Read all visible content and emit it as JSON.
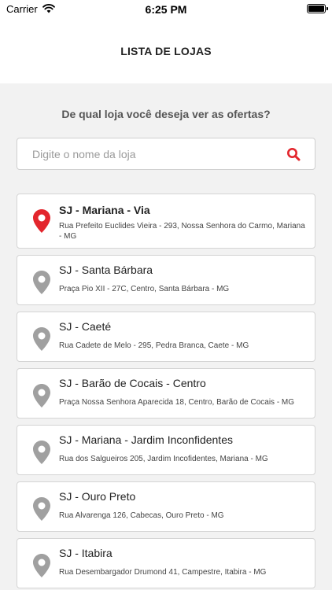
{
  "status_bar": {
    "carrier": "Carrier",
    "time": "6:25 PM"
  },
  "header": {
    "title": "LISTA DE LOJAS"
  },
  "prompt": "De qual loja você deseja ver as ofertas?",
  "search": {
    "placeholder": "Digite o nome da loja",
    "value": ""
  },
  "colors": {
    "accent": "#e3262d",
    "pin_inactive": "#a0a0a0"
  },
  "stores": [
    {
      "name": "SJ - Mariana - Via",
      "address": "Rua Prefeito Euclides Vieira - 293, Nossa Senhora do Carmo, Mariana - MG",
      "selected": true,
      "icon": "map-pin-icon"
    },
    {
      "name": "SJ - Santa Bárbara",
      "address": "Praça Pio XII - 27C, Centro, Santa Bárbara - MG",
      "selected": false,
      "icon": "map-pin-icon"
    },
    {
      "name": "SJ - Caeté",
      "address": "Rua Cadete de Melo - 295, Pedra Branca, Caete - MG",
      "selected": false,
      "icon": "map-pin-icon"
    },
    {
      "name": "SJ - Barão de Cocais - Centro",
      "address": "Praça Nossa Senhora Aparecida 18, Centro, Barão de Cocais - MG",
      "selected": false,
      "icon": "map-pin-icon"
    },
    {
      "name": "SJ - Mariana - Jardim Inconfidentes",
      "address": "Rua dos Salgueiros 205, Jardim Incofidentes, Mariana - MG",
      "selected": false,
      "icon": "map-pin-icon"
    },
    {
      "name": "SJ - Ouro Preto",
      "address": "Rua Alvarenga 126, Cabecas, Ouro Preto - MG",
      "selected": false,
      "icon": "map-pin-icon"
    },
    {
      "name": "SJ - Itabira",
      "address": "Rua Desembargador Drumond 41, Campestre, Itabira - MG",
      "selected": false,
      "icon": "map-pin-icon"
    }
  ]
}
